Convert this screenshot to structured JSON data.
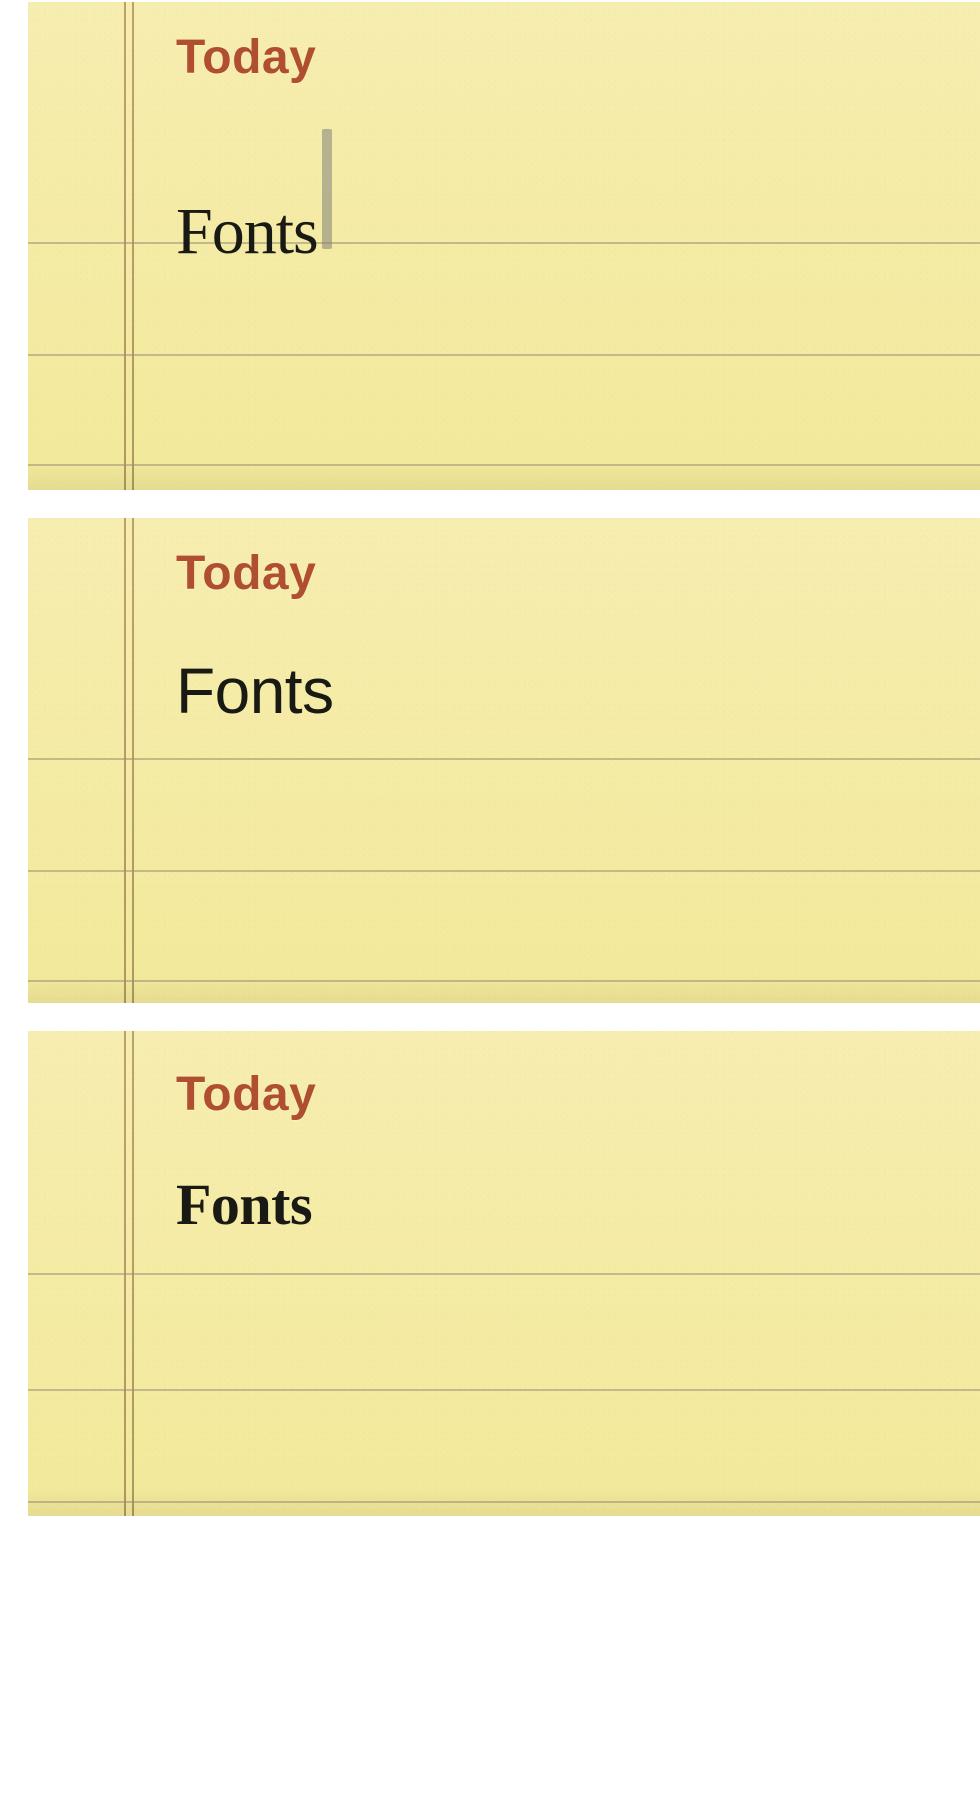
{
  "panels": [
    {
      "date_label": "Today",
      "note_text": "Fonts",
      "font_style": "Marker Felt",
      "has_cursor": true
    },
    {
      "date_label": "Today",
      "note_text": "Fonts",
      "font_style": "Helvetica",
      "has_cursor": false
    },
    {
      "date_label": "Today",
      "note_text": "Fonts",
      "font_style": "Chalkboard",
      "has_cursor": false
    }
  ],
  "colors": {
    "paper_top": "#f6edb0",
    "paper_bottom": "#f3e99a",
    "rule_line": "#9c9076",
    "margin_line": "#a88857",
    "date_color": "#b04e31",
    "text_color": "#1a1a14"
  }
}
